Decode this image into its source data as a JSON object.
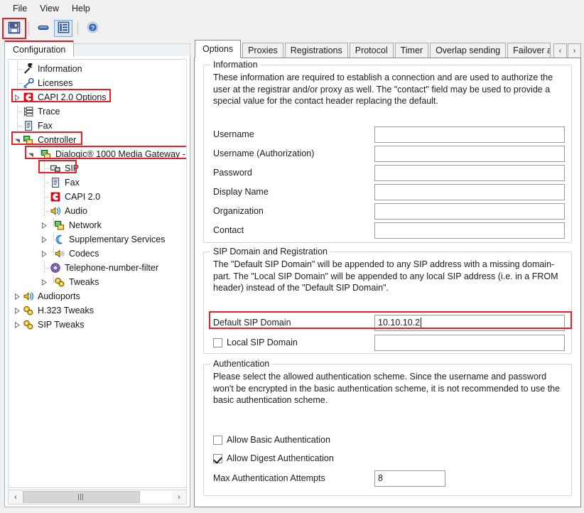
{
  "window": {
    "accent_red": "#ee1c24",
    "tab_border": "#888888"
  },
  "menubar": {
    "items": [
      {
        "label": "File",
        "name": "menu-file"
      },
      {
        "label": "View",
        "name": "menu-view"
      },
      {
        "label": "Help",
        "name": "menu-help"
      }
    ]
  },
  "toolbar": {
    "buttons": [
      {
        "label": "Save",
        "icon": "save-floppy-icon",
        "highlighted": true,
        "selected": false
      },
      {
        "label": "Collapse",
        "icon": "minimize-bar-icon",
        "highlighted": false,
        "selected": false
      },
      {
        "label": "Show Tree",
        "icon": "tree-list-icon",
        "highlighted": false,
        "selected": true
      },
      {
        "label": "Help",
        "icon": "help-question-icon",
        "highlighted": false,
        "selected": false
      }
    ]
  },
  "left_pane": {
    "tab_label": "Configuration",
    "scrollbar": {
      "left_arrow": "‹",
      "right_arrow": "›"
    },
    "tree": [
      {
        "label": "Information",
        "icon": "wrench-icon",
        "depth": 1,
        "expander": "none",
        "guide": "elbowmid",
        "highlight": false
      },
      {
        "label": "Licenses",
        "icon": "key-icon",
        "depth": 1,
        "expander": "none",
        "guide": "elbowmid",
        "highlight": false
      },
      {
        "label": "CAPI 2.0 Options",
        "icon": "capi-c-icon",
        "depth": 1,
        "expander": "collapsed",
        "guide": "none",
        "highlight": true
      },
      {
        "label": "Trace",
        "icon": "trace-list-icon",
        "depth": 1,
        "expander": "none",
        "guide": "elbowmid",
        "highlight": false
      },
      {
        "label": "Fax",
        "icon": "fax-doc-icon",
        "depth": 1,
        "expander": "none",
        "guide": "elbowmid",
        "highlight": false
      },
      {
        "label": "Controller",
        "icon": "controller-icon",
        "depth": 1,
        "expander": "expanded",
        "guide": "none",
        "highlight": true
      },
      {
        "label": "Dialogic® 1000 Media Gateway -",
        "icon": "controller-icon",
        "depth": 2,
        "expander": "expanded",
        "guide": "dotv",
        "highlight": true
      },
      {
        "label": "SIP",
        "icon": "sip-device-icon",
        "depth": 3,
        "expander": "none",
        "guide": "elbowmid",
        "highlight": true
      },
      {
        "label": "Fax",
        "icon": "fax-doc-icon",
        "depth": 3,
        "expander": "none",
        "guide": "elbowmid",
        "highlight": false
      },
      {
        "label": "CAPI 2.0",
        "icon": "capi-c-icon",
        "depth": 3,
        "expander": "none",
        "guide": "elbowmid",
        "highlight": false
      },
      {
        "label": "Audio",
        "icon": "audio-speaker-icon",
        "depth": 3,
        "expander": "none",
        "guide": "elbowmid",
        "highlight": false
      },
      {
        "label": "Network",
        "icon": "controller-icon",
        "depth": 3,
        "expander": "collapsed",
        "guide": "dotv",
        "highlight": false
      },
      {
        "label": "Supplementary Services",
        "icon": "moon-icon",
        "depth": 3,
        "expander": "collapsed",
        "guide": "dotv",
        "highlight": false
      },
      {
        "label": "Codecs",
        "icon": "codec-speaker-icon",
        "depth": 3,
        "expander": "collapsed",
        "guide": "dotv",
        "highlight": false
      },
      {
        "label": "Telephone-number-filter",
        "icon": "filter-wheel-icon",
        "depth": 3,
        "expander": "none",
        "guide": "elbowmid",
        "highlight": false
      },
      {
        "label": "Tweaks",
        "icon": "gears-icon",
        "depth": 3,
        "expander": "collapsed",
        "guide": "dotv",
        "highlight": false
      },
      {
        "label": "Audioports",
        "icon": "audio-speaker-icon",
        "depth": 1,
        "expander": "collapsed",
        "guide": "none",
        "highlight": false
      },
      {
        "label": "H.323 Tweaks",
        "icon": "gears-icon",
        "depth": 1,
        "expander": "collapsed",
        "guide": "none",
        "highlight": false
      },
      {
        "label": "SIP Tweaks",
        "icon": "gears-icon",
        "depth": 1,
        "expander": "collapsed",
        "guide": "none",
        "highlight": false
      }
    ]
  },
  "right_pane": {
    "tabs": [
      {
        "label": "Options",
        "active": true,
        "clipped": false
      },
      {
        "label": "Proxies",
        "active": false,
        "clipped": false
      },
      {
        "label": "Registrations",
        "active": false,
        "clipped": false
      },
      {
        "label": "Protocol",
        "active": false,
        "clipped": false
      },
      {
        "label": "Timer",
        "active": false,
        "clipped": false
      },
      {
        "label": "Overlap sending",
        "active": false,
        "clipped": false
      },
      {
        "label": "Failover and Ov",
        "active": false,
        "clipped": true
      }
    ],
    "tab_scroll": {
      "prev": "‹",
      "next": "›"
    },
    "information": {
      "title": "Information",
      "description": "These information are required to establish a connection and are used to authorize the user at the registrar and/or proxy as well. The \"contact\" field may be used to provide a special value for the contact header replacing the default.",
      "fields": [
        {
          "label": "Username",
          "value": "",
          "name": "username-field"
        },
        {
          "label": "Username (Authorization)",
          "value": "",
          "name": "username-authorization-field"
        },
        {
          "label": "Password",
          "value": "",
          "name": "password-field"
        },
        {
          "label": "Display Name",
          "value": "",
          "name": "display-name-field"
        },
        {
          "label": "Organization",
          "value": "",
          "name": "organization-field"
        },
        {
          "label": "Contact",
          "value": "",
          "name": "contact-field"
        }
      ]
    },
    "sip_domain": {
      "title": "SIP Domain and Registration",
      "description": "The \"Default SIP Domain\" will be appended to any SIP address with a missing domain-part. The \"Local SIP Domain\" will be appended to any local SIP address (i.e. in a FROM header) instead of the \"Default SIP Domain\".",
      "default_sip_domain": {
        "label": "Default SIP Domain",
        "value": "10.10.10.2",
        "highlighted": true,
        "focused": true
      },
      "local_sip_domain": {
        "label": "Local SIP Domain",
        "value": "",
        "checked": false
      }
    },
    "authentication": {
      "title": "Authentication",
      "description": "Please select the allowed authentication scheme. Since the username and password won't be encrypted in the basic authentication scheme, it is not recommended to use the basic authentication scheme.",
      "allow_basic": {
        "label": "Allow Basic Authentication",
        "checked": false
      },
      "allow_digest": {
        "label": "Allow Digest Authentication",
        "checked": true
      },
      "max_attempts": {
        "label": "Max Authentication Attempts",
        "value": "8"
      }
    }
  }
}
